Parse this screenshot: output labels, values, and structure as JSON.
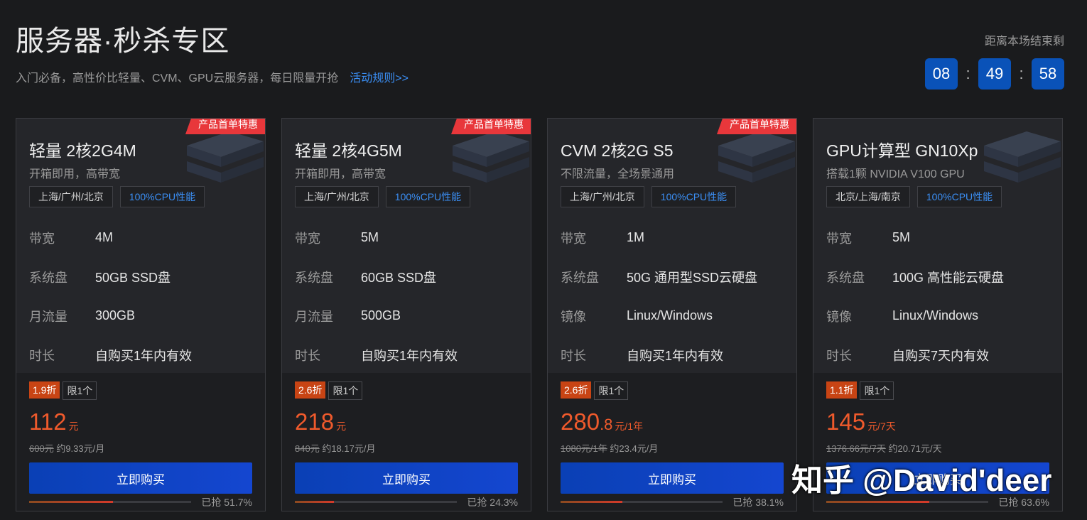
{
  "header": {
    "title": "服务器·秒杀专区",
    "subtitle": "入门必备，高性价比轻量、CVM、GPU云服务器，每日限量开抢",
    "rules_link": "活动规则>>"
  },
  "countdown": {
    "label": "距离本场结束剩",
    "hours": "08",
    "minutes": "49",
    "seconds": "58",
    "separator": ":"
  },
  "cards": [
    {
      "badge": "产品首单特惠",
      "name": "轻量 2核2G4M",
      "desc": "开箱即用，高带宽",
      "tags": [
        "上海/广州/北京",
        "100%CPU性能"
      ],
      "specs": [
        {
          "k": "带宽",
          "v": "4M"
        },
        {
          "k": "系统盘",
          "v": "50GB SSD盘"
        },
        {
          "k": "月流量",
          "v": "300GB"
        },
        {
          "k": "时长",
          "v": "自购买1年内有效"
        }
      ],
      "discount": "1.9折",
      "limit": "限1个",
      "price": "112",
      "price_decimal": "",
      "unit": "元",
      "original": "600元",
      "per_month": "约9.33元/月",
      "buy_label": "立即购买",
      "sold_text": "已抢 51.7%",
      "sold_fraction": 0.517
    },
    {
      "badge": "产品首单特惠",
      "name": "轻量 2核4G5M",
      "desc": "开箱即用，高带宽",
      "tags": [
        "上海/广州/北京",
        "100%CPU性能"
      ],
      "specs": [
        {
          "k": "带宽",
          "v": "5M"
        },
        {
          "k": "系统盘",
          "v": "60GB SSD盘"
        },
        {
          "k": "月流量",
          "v": "500GB"
        },
        {
          "k": "时长",
          "v": "自购买1年内有效"
        }
      ],
      "discount": "2.6折",
      "limit": "限1个",
      "price": "218",
      "price_decimal": "",
      "unit": "元",
      "original": "840元",
      "per_month": "约18.17元/月",
      "buy_label": "立即购买",
      "sold_text": "已抢 24.3%",
      "sold_fraction": 0.243
    },
    {
      "badge": "产品首单特惠",
      "name": "CVM 2核2G S5",
      "desc": "不限流量，全场景通用",
      "tags": [
        "上海/广州/北京",
        "100%CPU性能"
      ],
      "specs": [
        {
          "k": "带宽",
          "v": "1M"
        },
        {
          "k": "系统盘",
          "v": "50G 通用型SSD云硬盘"
        },
        {
          "k": "镜像",
          "v": "Linux/Windows"
        },
        {
          "k": "时长",
          "v": "自购买1年内有效"
        }
      ],
      "discount": "2.6折",
      "limit": "限1个",
      "price": "280",
      "price_decimal": ".8",
      "unit": "元/1年",
      "original": "1080元/1年",
      "per_month": "约23.4元/月",
      "buy_label": "立即购买",
      "sold_text": "已抢 38.1%",
      "sold_fraction": 0.381
    },
    {
      "badge": "",
      "name": "GPU计算型 GN10Xp",
      "desc": "搭载1颗 NVIDIA V100 GPU",
      "tags": [
        "北京/上海/南京",
        "100%CPU性能"
      ],
      "specs": [
        {
          "k": "带宽",
          "v": "5M"
        },
        {
          "k": "系统盘",
          "v": "100G 高性能云硬盘"
        },
        {
          "k": "镜像",
          "v": "Linux/Windows"
        },
        {
          "k": "时长",
          "v": "自购买7天内有效"
        }
      ],
      "discount": "1.1折",
      "limit": "限1个",
      "price": "145",
      "price_decimal": "",
      "unit": "元/7天",
      "original": "1376.66元/7天",
      "per_month": "约20.71元/天",
      "buy_label": "立即购买",
      "sold_text": "已抢 63.6%",
      "sold_fraction": 0.636
    }
  ],
  "watermark": "知乎 @David'deer"
}
